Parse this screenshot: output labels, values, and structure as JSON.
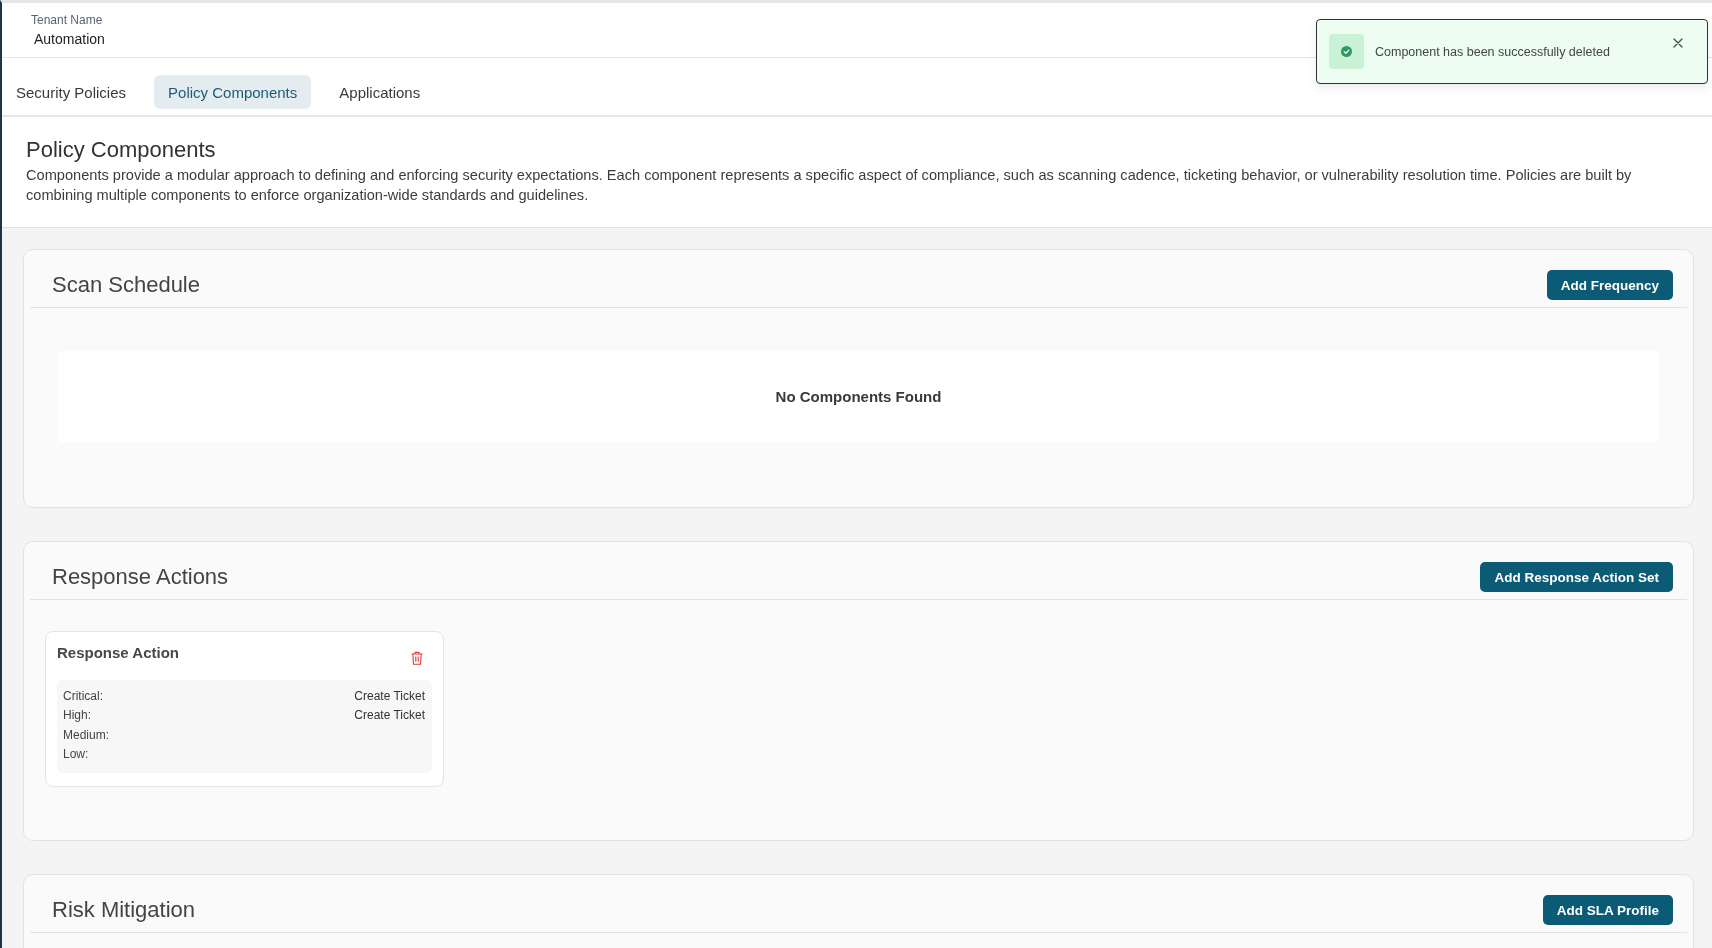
{
  "header": {
    "label": "Tenant Name",
    "value": "Automation"
  },
  "tabs": [
    {
      "label": "Security Policies",
      "selected": false
    },
    {
      "label": "Policy Components",
      "selected": true
    },
    {
      "label": "Applications",
      "selected": false
    }
  ],
  "intro": {
    "title": "Policy Components",
    "description": "Components provide a modular approach to defining and enforcing security expectations. Each component represents a specific aspect of compliance, such as scanning cadence, ticketing behavior, or vulnerability resolution time. Policies are built by combining multiple components to enforce organization-wide standards and guidelines."
  },
  "sections": [
    {
      "title": "Scan Schedule",
      "button": "Add Frequency",
      "kind": "empty",
      "empty_message": "No Components Found"
    },
    {
      "title": "Response Actions",
      "button": "Add Response Action Set",
      "kind": "cards",
      "cards": [
        {
          "title": "Response Action",
          "rows": [
            {
              "label": "Critical:",
              "value": "Create Ticket"
            },
            {
              "label": "High:",
              "value": "Create Ticket"
            },
            {
              "label": "Medium:"
            },
            {
              "label": "Low:"
            }
          ]
        }
      ]
    },
    {
      "title": "Risk Mitigation",
      "button": "Add SLA Profile"
    }
  ],
  "toast": {
    "message": "Component has been successfully deleted"
  }
}
